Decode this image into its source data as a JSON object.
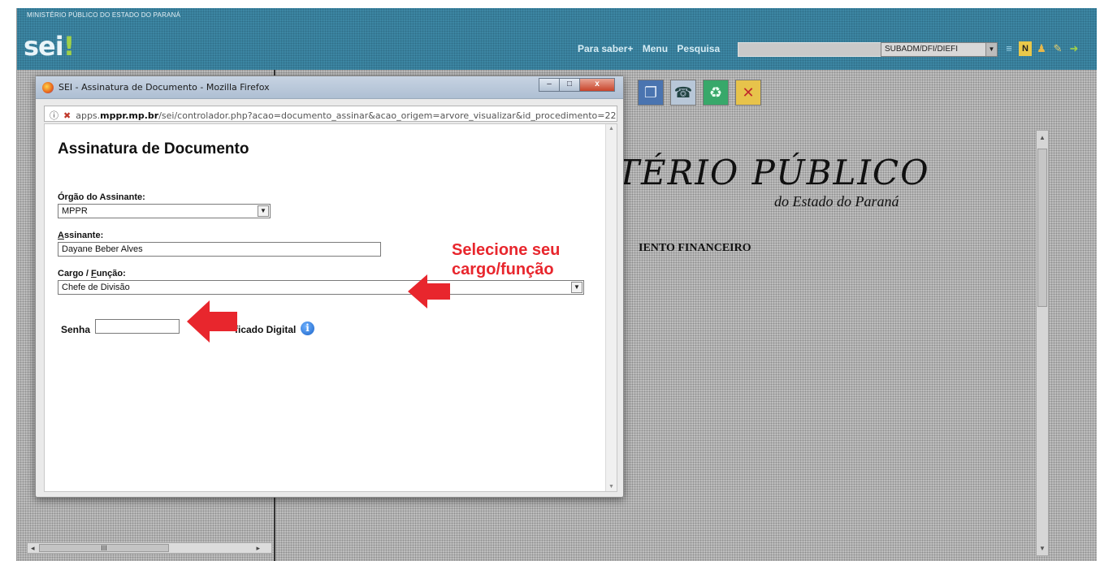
{
  "header": {
    "org_name": "MINISTÉRIO PÚBLICO DO ESTADO DO PARANÁ",
    "logo_text": "sei",
    "logo_bang": "!",
    "links": [
      "Para saber+",
      "Menu",
      "Pesquisa"
    ],
    "unit_select": "SUBADM/DFI/DIEFI",
    "icons": [
      "list-icon",
      "notification-icon",
      "user-icon",
      "wrench-icon",
      "exit-icon"
    ]
  },
  "document": {
    "heading": "TÉRIO PÚBLICO",
    "subheading": "do Estado do Paraná",
    "section": "IENTO FINANCEIRO",
    "toolbar_icons": [
      "copy-icon",
      "fax-icon",
      "trash-icon",
      "cancel-icon"
    ]
  },
  "dialog": {
    "window_title": "SEI - Assinatura de Documento - Mozilla Firefox",
    "url_prefix": "apps.",
    "url_domain": "mppr.mp.br",
    "url_rest": "/sei/controlador.php?acao=documento_assinar&acao_origem=arvore_visualizar&id_procedimento=22",
    "window_buttons": {
      "minimize": "–",
      "maximize": "□",
      "close": "x"
    },
    "form": {
      "title": "Assinatura de Documento",
      "orgao_label": "Órgão do Assinante:",
      "orgao_value": "MPPR",
      "assinante_label_first": "A",
      "assinante_label_rest": "ssinante:",
      "assinante_value": "Dayane Beber Alves",
      "cargo_label_start": "Cargo / ",
      "cargo_label_u": "F",
      "cargo_label_rest": "unção:",
      "cargo_value": "Chefe de Divisão",
      "senha_label": "Senha",
      "senha_value": "",
      "certificado_label": "ficado Digital"
    }
  },
  "annotation": {
    "line1": "Selecione seu",
    "line2": "cargo/função",
    "color": "#e8262d"
  },
  "scroll": {
    "hscroll_thumb": "III"
  }
}
